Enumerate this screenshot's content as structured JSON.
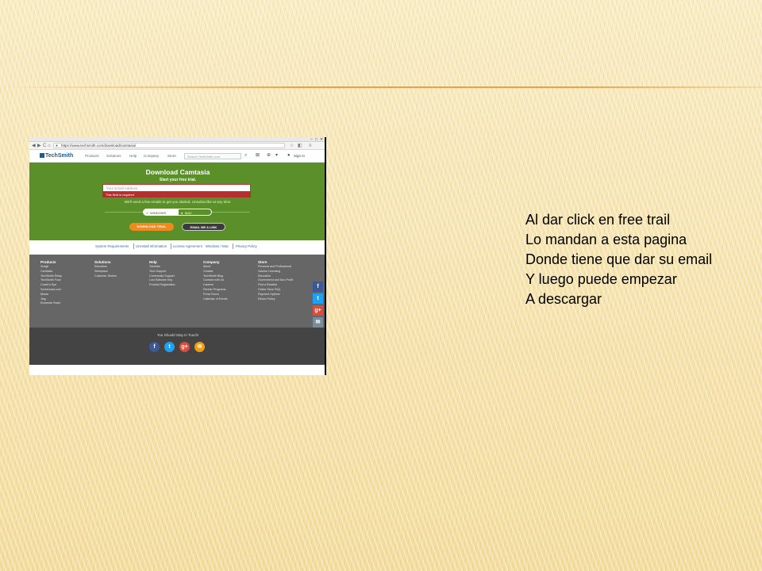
{
  "slide": {
    "lines": [
      "Al dar click en free trail",
      "Lo mandan a esta pagina",
      "Donde tiene que dar su email",
      "Y luego puede empezar",
      "A descargar"
    ]
  },
  "browser": {
    "url": "https://www.techsmith.com/download/camtasia/",
    "back_icon": "◀",
    "forward_icon": "▶",
    "reload_icon": "C",
    "home_icon": "⌂"
  },
  "site_nav": {
    "logo": "TechSmith",
    "items": [
      "Products",
      "Solutions",
      "Help",
      "Company",
      "Store"
    ],
    "search_placeholder": "Search TechSmith.com",
    "sign_in": "Sign In"
  },
  "hero": {
    "title": "Download Camtasia",
    "subtitle": "Start your free trial.",
    "email_placeholder": "Your Email Address",
    "error": "This field is required",
    "note": "We'll send a few emails to get you started. Unsubscribe at any time.",
    "os_windows": "WINDOWS",
    "os_mac": "MAC",
    "download_button": "DOWNLOAD TRIAL",
    "email_button": "EMAIL ME A LINK"
  },
  "links_row": {
    "system_requirements": "System Requirements",
    "uninstall": "Uninstall Information",
    "license": "License Agreement",
    "license_os": "Windows / Mac",
    "privacy": "Privacy Policy"
  },
  "footer": {
    "columns": [
      {
        "heading": "Products",
        "items": [
          "Snagit",
          "Camtasia",
          "TechSmith Relay",
          "TechSmith Fuse",
          "Coach's Eye",
          "Screencast.com",
          "Morae",
          "Jing",
          "Knowmia Teach"
        ]
      },
      {
        "heading": "Solutions",
        "items": [
          "Education",
          "Workplace",
          "Customer Stories"
        ]
      },
      {
        "heading": "Help",
        "items": [
          "Tutorials",
          "Tech Support",
          "Community Support",
          "Lost Software Key",
          "Product Registration"
        ]
      },
      {
        "heading": "Company",
        "items": [
          "About",
          "Contact",
          "TechSmith Blog",
          "Connect with Us",
          "Careers",
          "Partner Programs",
          "Press Room",
          "Calendar of Events"
        ]
      },
      {
        "heading": "Store",
        "items": [
          "Personal and Professional",
          "Volume Licensing",
          "Education",
          "Government and Non-Profit",
          "Find a Reseller",
          "Online Store FAQ",
          "Payment Options",
          "Return Policy"
        ]
      }
    ],
    "stay_in_touch": "You Should Stay In Touch!"
  },
  "colors": {
    "hero_green": "#5b8f2a",
    "download_orange": "#f08a1c",
    "error_red": "#b62f2f",
    "facebook": "#3b5998",
    "twitter": "#1da1f2",
    "googleplus": "#dd4b39",
    "email": "#f39c12"
  }
}
